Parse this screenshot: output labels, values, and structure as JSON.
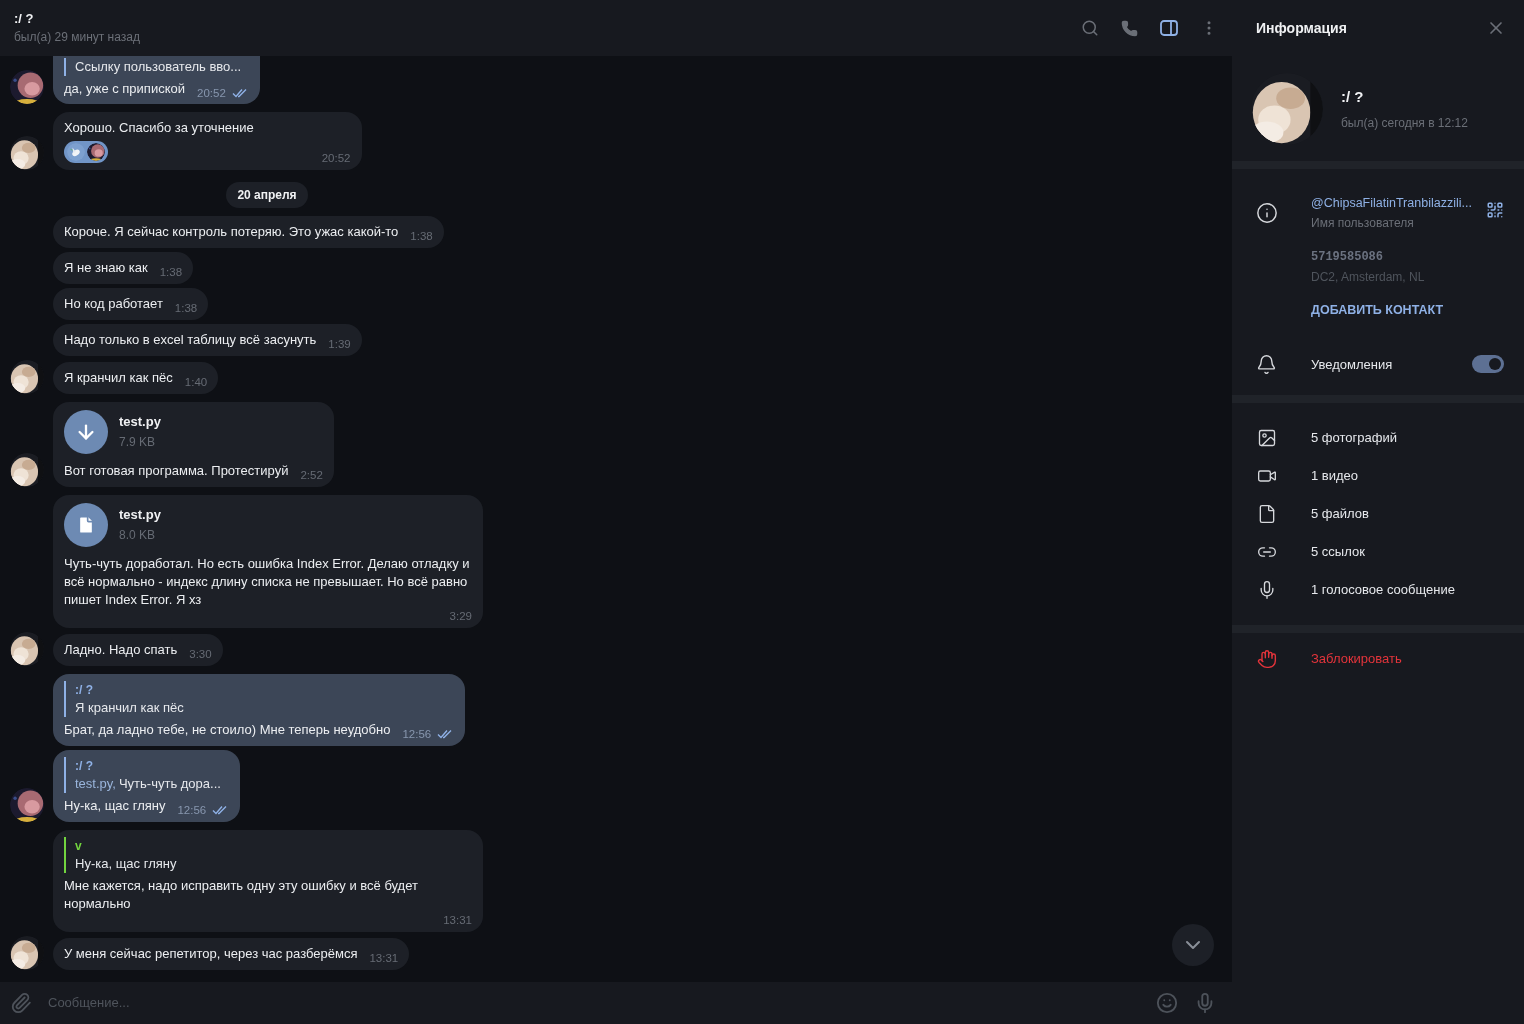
{
  "header": {
    "title": ":/ ?",
    "status": "был(а) 29 минут назад",
    "actions": [
      {
        "kind": "search",
        "active": false
      },
      {
        "kind": "call",
        "active": false
      },
      {
        "kind": "sidebar",
        "active": true
      },
      {
        "kind": "more",
        "active": false
      }
    ]
  },
  "messages": [
    {
      "kind": "message",
      "outgoing": true,
      "cut_top": true,
      "avatar": {
        "kind": "pink"
      },
      "reply": {
        "quote": "Ссылку пользователь вво...",
        "color": "#8fb1e6"
      },
      "text": "да, уже с припиской",
      "time": "20:52",
      "read": true
    },
    {
      "kind": "message",
      "outgoing": false,
      "avatar": {
        "kind": "cat"
      },
      "text": "Хорошо. Спасибо за уточнение",
      "reactions": [
        {
          "kind": "dove"
        },
        {
          "kind": "pink"
        }
      ],
      "time": "20:52"
    },
    {
      "kind": "date",
      "text": "20 апреля"
    },
    {
      "kind": "message",
      "outgoing": false,
      "text": "Короче. Я сейчас контроль потеряю. Это ужас какой-то",
      "time": "1:38"
    },
    {
      "kind": "message",
      "outgoing": false,
      "text": "Я не знаю как",
      "time": "1:38"
    },
    {
      "kind": "message",
      "outgoing": false,
      "text": "Но код работает",
      "time": "1:38"
    },
    {
      "kind": "message",
      "outgoing": false,
      "text": "Надо только в excel таблицу всё засунуть",
      "time": "1:39"
    },
    {
      "kind": "message",
      "outgoing": false,
      "avatar": {
        "kind": "cat"
      },
      "text": "Я кранчил как пёс",
      "time": "1:40"
    },
    {
      "kind": "message",
      "outgoing": false,
      "avatar": {
        "kind": "cat"
      },
      "file": {
        "kind": "download",
        "name": "test.py",
        "size": "7.9 KB"
      },
      "text": "Вот готовая программа. Протестируй",
      "time": "2:52"
    },
    {
      "kind": "message",
      "outgoing": false,
      "file": {
        "kind": "document",
        "name": "test.py",
        "size": "8.0 KB"
      },
      "text": "Чуть-чуть доработал. Но есть ошибка Index Error. Делаю отладку и всё нормально - индекс длину списка не превышает. Но всё равно пишет Index Error. Я хз",
      "time": "3:29"
    },
    {
      "kind": "message",
      "outgoing": false,
      "avatar": {
        "kind": "cat"
      },
      "text": "Ладно. Надо спать",
      "time": "3:30"
    },
    {
      "kind": "message",
      "outgoing": true,
      "reply": {
        "author": ":/ ?",
        "quote": "Я кранчил как пёс",
        "color": "#8fb1e6"
      },
      "text": "Брат, да ладно тебе, не стоило) Мне теперь неудобно",
      "time": "12:56",
      "read": true
    },
    {
      "kind": "message",
      "outgoing": true,
      "avatar": {
        "kind": "pink"
      },
      "reply": {
        "author": ":/ ?",
        "file": "test.py,",
        "quote": "Чуть-чуть дора...",
        "color": "#8fb1e6"
      },
      "text": "Ну-ка, щас гляну",
      "time": "12:56",
      "read": true
    },
    {
      "kind": "message",
      "outgoing": false,
      "reply": {
        "author": "v",
        "quote": "Ну-ка, щас гляну",
        "color": "#72d43f"
      },
      "text": "Мне кажется, надо исправить одну эту ошибку и всё будет нормально",
      "time": "13:31"
    },
    {
      "kind": "message",
      "outgoing": false,
      "avatar": {
        "kind": "cat"
      },
      "text": "У меня сейчас репетитор, через час разберёмся",
      "time": "13:31"
    }
  ],
  "composer": {
    "placeholder": "Сообщение..."
  },
  "info": {
    "title": "Информация",
    "name": ":/ ?",
    "status": "был(а) сегодня в 12:12",
    "username": "@ChipsaFilatinTranbilazzili...",
    "username_label": "Имя пользователя",
    "user_id": "5719585086",
    "datacenter": "DC2, Amsterdam, NL",
    "add_contact": "ДОБАВИТЬ КОНТАКТ",
    "notifications": {
      "label": "Уведомления",
      "on": true
    },
    "media": [
      {
        "kind": "photos",
        "label": "5 фотографий"
      },
      {
        "kind": "video",
        "label": "1 видео"
      },
      {
        "kind": "files",
        "label": "5 файлов"
      },
      {
        "kind": "links",
        "label": "5 ссылок"
      },
      {
        "kind": "voice",
        "label": "1 голосовое сообщение"
      }
    ],
    "block": "Заблокировать"
  }
}
